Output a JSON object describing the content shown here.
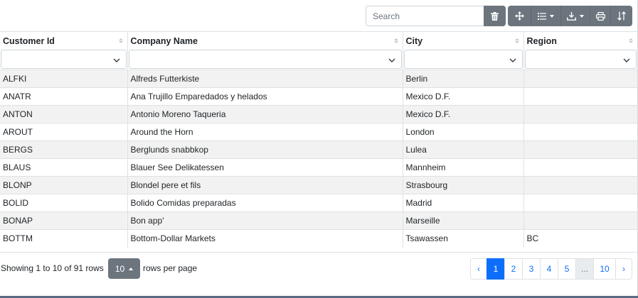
{
  "toolbar": {
    "search_placeholder": "Search",
    "icons": [
      "trash-icon",
      "arrows-move-icon",
      "list-columns-icon",
      "download-icon",
      "print-icon",
      "sort-toggle-icon"
    ]
  },
  "table": {
    "columns": [
      "Customer Id",
      "Company Name",
      "City",
      "Region"
    ],
    "rows": [
      [
        "ALFKI",
        "Alfreds Futterkiste",
        "Berlin",
        ""
      ],
      [
        "ANATR",
        "Ana Trujillo Emparedados y helados",
        "Mexico D.F.",
        ""
      ],
      [
        "ANTON",
        "Antonio Moreno Taqueria",
        "Mexico D.F.",
        ""
      ],
      [
        "AROUT",
        "Around the Horn",
        "London",
        ""
      ],
      [
        "BERGS",
        "Berglunds snabbkop",
        "Lulea",
        ""
      ],
      [
        "BLAUS",
        "Blauer See Delikatessen",
        "Mannheim",
        ""
      ],
      [
        "BLONP",
        "Blondel pere et fils",
        "Strasbourg",
        ""
      ],
      [
        "BOLID",
        "Bolido Comidas preparadas",
        "Madrid",
        ""
      ],
      [
        "BONAP",
        "Bon app'",
        "Marseille",
        ""
      ],
      [
        "BOTTM",
        "Bottom-Dollar Markets",
        "Tsawassen",
        "BC"
      ]
    ]
  },
  "footer": {
    "info": "Showing 1 to 10 of 91 rows",
    "page_size": "10",
    "rows_per_page_label": "rows per page"
  },
  "pagination": {
    "prev": "‹",
    "pages": [
      "1",
      "2",
      "3",
      "4",
      "5"
    ],
    "ellipsis": "...",
    "last_page": "10",
    "next": "›",
    "active": "1"
  },
  "colors": {
    "accent": "#0d6efd",
    "button": "#6c757d",
    "row_stripe": "#f2f2f2"
  }
}
